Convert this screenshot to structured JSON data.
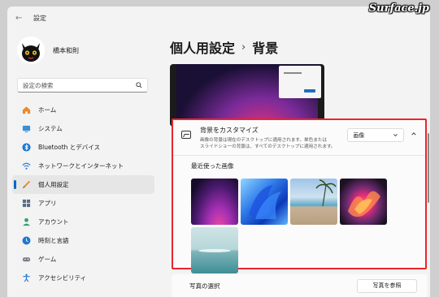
{
  "watermark": "Surface.jp",
  "window": {
    "title": "設定"
  },
  "profile": {
    "name": "橋本和則"
  },
  "search": {
    "placeholder": "設定の検索"
  },
  "sidebar": {
    "items": [
      {
        "label": "ホーム",
        "icon": "home-icon"
      },
      {
        "label": "システム",
        "icon": "system-icon"
      },
      {
        "label": "Bluetooth とデバイス",
        "icon": "bluetooth-icon"
      },
      {
        "label": "ネットワークとインターネット",
        "icon": "network-icon"
      },
      {
        "label": "個人用設定",
        "icon": "personalization-icon",
        "active": true
      },
      {
        "label": "アプリ",
        "icon": "apps-icon"
      },
      {
        "label": "アカウント",
        "icon": "account-icon"
      },
      {
        "label": "時刻と言語",
        "icon": "time-language-icon"
      },
      {
        "label": "ゲーム",
        "icon": "gaming-icon"
      },
      {
        "label": "アクセシビリティ",
        "icon": "accessibility-icon"
      }
    ]
  },
  "breadcrumb": {
    "parent": "個人用設定",
    "separator": "›",
    "current": "背景"
  },
  "background_card": {
    "title": "背景をカスタマイズ",
    "description_line1": "画像の背景は現在のデスクトップに適用されます。単色または",
    "description_line2": "スライドショーの背景は、すべてのデスクトップに適用されます。",
    "dropdown_value": "画像",
    "recent_label": "最近使った画像"
  },
  "photo_row": {
    "label": "写真の選択",
    "button": "写真を参照"
  },
  "colors": {
    "accent": "#0067c0",
    "highlight_border": "#e8262b"
  }
}
